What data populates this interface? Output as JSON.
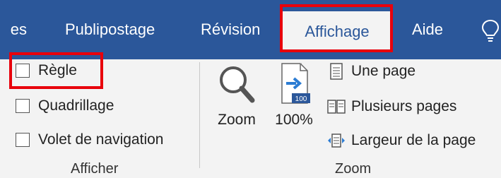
{
  "tabs": {
    "partial": "es",
    "mailings": "Publipostage",
    "review": "Révision",
    "view": "Affichage",
    "help": "Aide"
  },
  "show_group": {
    "label": "Afficher",
    "items": [
      {
        "label": "Règle",
        "checked": false
      },
      {
        "label": "Quadrillage",
        "checked": false
      },
      {
        "label": "Volet de navigation",
        "checked": false
      }
    ]
  },
  "zoom_group": {
    "label": "Zoom",
    "zoom_button": "Zoom",
    "hundred_button": "100%",
    "hundred_badge": "100",
    "one_page": "Une page",
    "multiple_pages": "Plusieurs pages",
    "page_width": "Largeur de la page"
  },
  "colors": {
    "accent": "#2b579a",
    "highlight": "#e8000b",
    "ribbon_bg": "#f3f3f3"
  },
  "icons": [
    "tell-me-lightbulb-icon",
    "zoom-magnifier-icon",
    "zoom-100-icon",
    "one-page-icon",
    "multiple-pages-icon",
    "page-width-icon"
  ]
}
